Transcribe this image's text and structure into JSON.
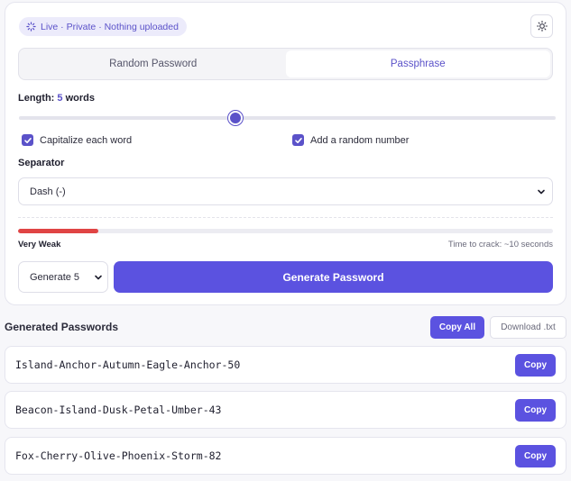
{
  "badge": {
    "text": "Live · Private · Nothing uploaded"
  },
  "tabs": [
    {
      "label": "Random Password",
      "active": false
    },
    {
      "label": "Passphrase",
      "active": true
    }
  ],
  "length": {
    "prefix": "Length:",
    "value": "5",
    "suffix": "words",
    "slider_fraction": 0.41
  },
  "options": {
    "capitalize": {
      "label": "Capitalize each word",
      "checked": true
    },
    "number": {
      "label": "Add a random number",
      "checked": true
    }
  },
  "separator": {
    "label": "Separator",
    "value": "Dash (-)"
  },
  "strength": {
    "label": "Very Weak",
    "fraction": 0.15,
    "color": "#e04444"
  },
  "crack_time": "Time to crack: ~10 seconds",
  "generate": {
    "count_value": "Generate 5",
    "button_label": "Generate Password"
  },
  "results": {
    "title": "Generated Passwords",
    "copy_all_label": "Copy All",
    "download_label": "Download .txt",
    "items": [
      {
        "password": "Island-Anchor-Autumn-Eagle-Anchor-50",
        "copy_label": "Copy"
      },
      {
        "password": "Beacon-Island-Dusk-Petal-Umber-43",
        "copy_label": "Copy"
      },
      {
        "password": "Fox-Cherry-Olive-Phoenix-Storm-82",
        "copy_label": "Copy"
      }
    ]
  },
  "colors": {
    "accent": "#5b52e0",
    "danger": "#e04444"
  },
  "icons": {
    "badge": "spinner-icon",
    "theme": "sun-icon",
    "checkbox": "check-icon",
    "dropdown": "chevron-down-icon"
  }
}
